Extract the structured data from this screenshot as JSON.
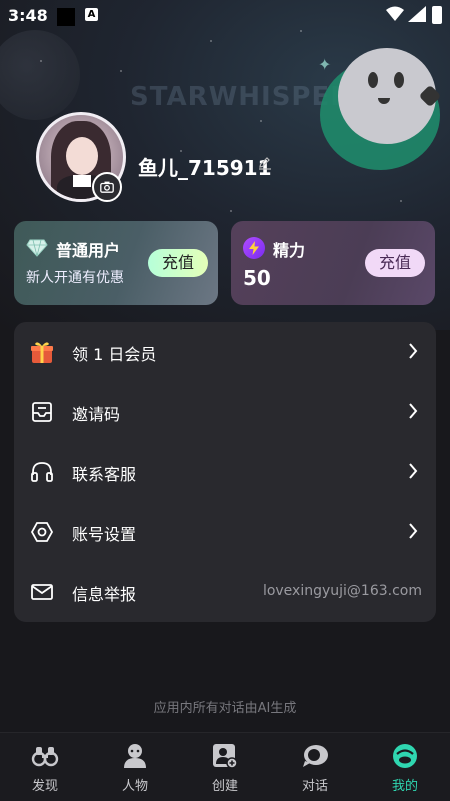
{
  "status_bar": {
    "time": "3:48",
    "notification_letter": "A"
  },
  "banner": {
    "watermark": "STARWHISPER"
  },
  "profile": {
    "username": "鱼儿_715911"
  },
  "cards": [
    {
      "title": "普通用户",
      "subtitle": "新人开通有优惠",
      "button": "充值",
      "icon": "diamond-icon"
    },
    {
      "title": "精力",
      "value": "50",
      "button": "充值",
      "icon": "lightning-icon"
    }
  ],
  "menu": [
    {
      "label": "领 1 日会员",
      "icon": "gift-icon",
      "has_chevron": true
    },
    {
      "label": "邀请码",
      "icon": "inbox-icon",
      "has_chevron": true
    },
    {
      "label": "联系客服",
      "icon": "headphones-icon",
      "has_chevron": true
    },
    {
      "label": "账号设置",
      "icon": "settings-hexagon-icon",
      "has_chevron": true
    },
    {
      "label": "信息举报",
      "icon": "mail-icon",
      "value": "lovexingyuji@163.com"
    }
  ],
  "footer_note": "应用内所有对话由AI生成",
  "nav": [
    {
      "label": "发现",
      "icon": "binoculars-icon"
    },
    {
      "label": "人物",
      "icon": "character-icon"
    },
    {
      "label": "创建",
      "icon": "create-icon"
    },
    {
      "label": "对话",
      "icon": "chat-icon"
    },
    {
      "label": "我的",
      "icon": "profile-icon",
      "active": true
    }
  ],
  "colors": {
    "accent": "#2fd6b0",
    "background": "#18181c",
    "menu_bg": "#29292e"
  }
}
